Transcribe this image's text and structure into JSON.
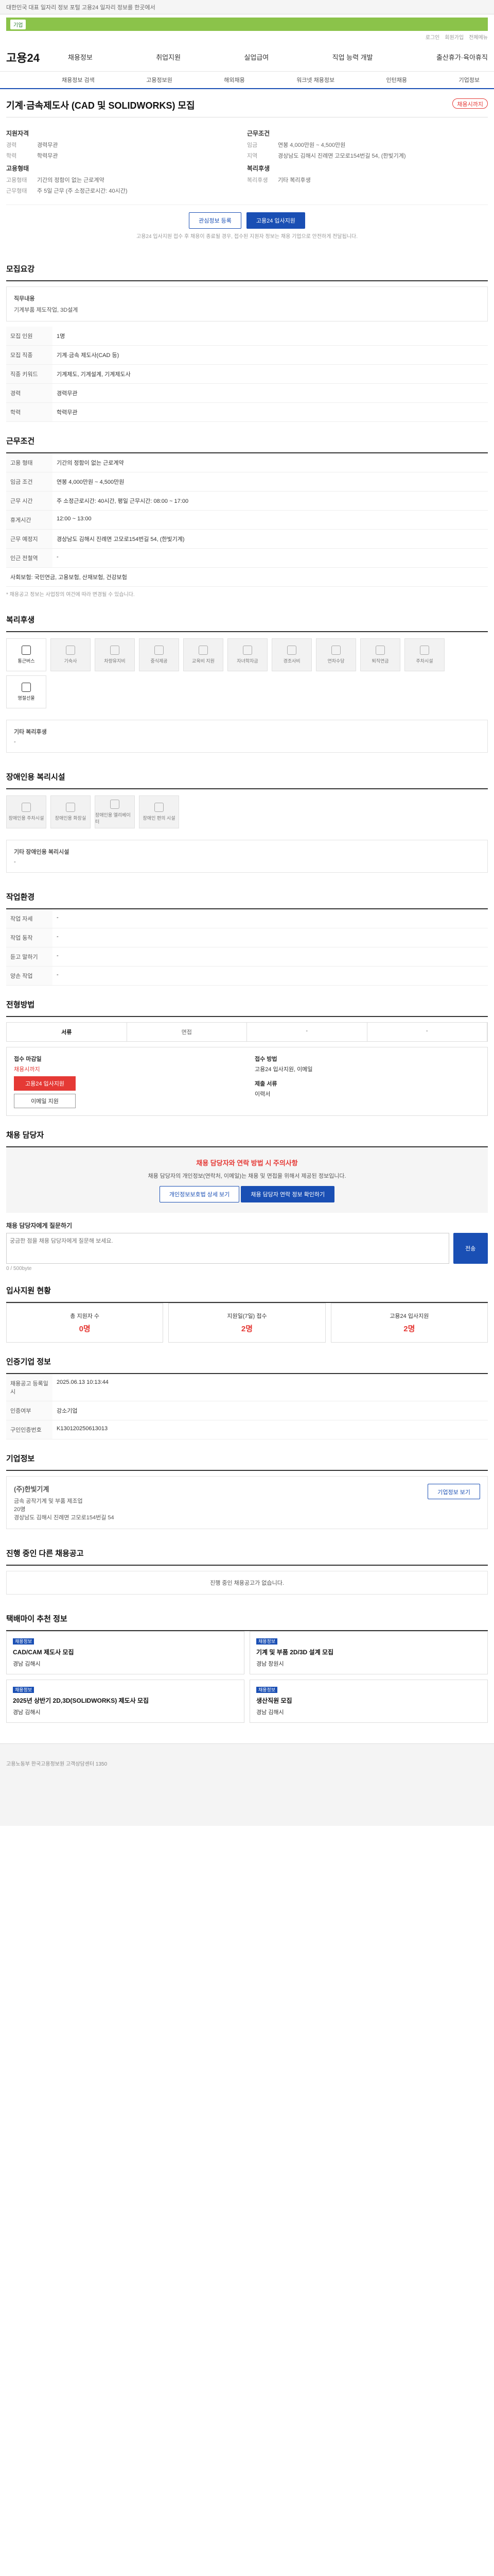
{
  "topbar": {
    "notice": "대한민국 대표 일자리 정보 포털 고용24 일자리 정보를 한곳에서"
  },
  "greenbar": {
    "tag": "기업"
  },
  "subline": [
    "로그인",
    "회원가입",
    "전체메뉴"
  ],
  "gnb": {
    "logo": "고용24",
    "menu": [
      "채용정보",
      "취업지원",
      "실업급여",
      "직업 능력 개발",
      "출산휴가·육아휴직"
    ]
  },
  "snb": [
    "채용정보 검색",
    "고용정보원",
    "해외채용",
    "워크넷 채용정보",
    "인턴채용",
    "기업정보"
  ],
  "job": {
    "title": "기계·금속제도사 (CAD 및 SOLIDWORKS) 모집",
    "badge": "채용시까지",
    "left_head": "지원자격",
    "left": [
      {
        "k": "경력",
        "v": "경력무관"
      },
      {
        "k": "학력",
        "v": "학력무관"
      }
    ],
    "left_head2": "고용형태",
    "left2": [
      {
        "k": "고용형태",
        "v": "기간의 정함이 없는 근로계약"
      },
      {
        "k": "근무형태",
        "v": "주 5일 근무 (주 소정근로시간: 40시간)"
      }
    ],
    "right_head": "근무조건",
    "right": [
      {
        "k": "임금",
        "v": "연봉 4,000만원 ~ 4,500만원"
      },
      {
        "k": "지역",
        "v": "경상남도 김해시 진례면 고모로154번길 54, (한빛기계)"
      }
    ],
    "right_head2": "복리후생",
    "right2": [
      {
        "k": "복리후생",
        "v": "기타 복리후생"
      }
    ]
  },
  "buttons": {
    "scrap": "관심정보 등록",
    "apply": "고용24 입사지원"
  },
  "note": "고용24 입사지원 접수 후 채용이 종료될 경우, 접수된 지원자 정보는 채용 기업으로 안전하게 전달됩니다.",
  "sections": {
    "recruit": "모집요강",
    "work": "근무조건",
    "welfare": "복리후생",
    "disability": "장애인용 복리시설",
    "workenv": "작업환경",
    "process": "전형방법",
    "apply_check": "채용 담당자",
    "stats": "입사지원 현황",
    "company_auth": "인증기업 정보",
    "company": "기업정보",
    "other_jobs": "진행 중인 다른 채용공고",
    "recommend": "택배마이 추천 정보"
  },
  "recruit": {
    "duty_label": "직무내용",
    "duty": "기계부품 제도작업, 3D설계",
    "rows": [
      {
        "h": "모집 인원",
        "v": "1명"
      },
      {
        "h": "모집 직종",
        "v": "기계·금속 제도사(CAD 등)"
      },
      {
        "h": "직종 키워드",
        "v": "기계제도, 기계설계, 기계제도사"
      },
      {
        "h": "경력",
        "v": "경력무관"
      },
      {
        "h": "학력",
        "v": "학력무관"
      }
    ]
  },
  "work": {
    "rows": [
      {
        "h": "고용 형태",
        "v": "기간의 정함이 없는 근로계약"
      },
      {
        "h": "근무 시간",
        "v": "주 소정근로시간: 40시간, 평일 근무시간: 08:00 ~ 17:00"
      },
      {
        "h": "휴게시간",
        "v": "12:00 ~ 13:00"
      },
      {
        "h": "근무 예정지",
        "v": "경상남도 김해시 진례면 고모로154번길 54, (한빛기계)"
      },
      {
        "h": "인근 전철역",
        "v": "-"
      }
    ],
    "wage_label": "임금 조건",
    "wage": "연봉 4,000만원 ~ 4,500만원",
    "insurance": "사회보험: 국민연금, 고용보험, 산재보험, 건강보험",
    "note": "* 채용공고 정보는 사업장의 여건에 따라 변경될 수 있습니다."
  },
  "welfare": {
    "items": [
      "통근버스",
      "기숙사",
      "차량유지비",
      "중식제공",
      "교육비 지원",
      "자녀학자금",
      "경조사비",
      "연차수당",
      "퇴직연금",
      "주차시설",
      "명절선물"
    ],
    "on": [
      0,
      10
    ],
    "etc_label": "기타 복리후생",
    "etc": "-"
  },
  "disability": {
    "items": [
      "장애인용 주차시설",
      "장애인용 화장실",
      "장애인용 엘리베이터",
      "장애인 편의 시설"
    ],
    "etc_label": "기타 장애인용 복리시설",
    "etc": "-"
  },
  "workenv": {
    "rows": [
      {
        "h": "작업 자세",
        "v": "-"
      },
      {
        "h": "작업 동작",
        "v": "-"
      },
      {
        "h": "듣고 말하기",
        "v": "-"
      },
      {
        "h": "양손 작업",
        "v": "-"
      }
    ]
  },
  "process": {
    "tabs": [
      "서류",
      "면접",
      "-",
      "-"
    ],
    "apply_label": "접수 마감일",
    "apply_date": "채용시까지",
    "apply_btn": "고용24 입사지원",
    "mail_btn": "이메일 지원",
    "method_label": "접수 방법",
    "method": "고용24 입사지원, 이메일",
    "doc_label": "제출 서류",
    "doc": "이력서"
  },
  "apply_check": {
    "title": "채용 담당자와 연락 방법 시 주의사항",
    "body": "채용 담당자의 개인정보(연락처, 이메일)는 채용 및 면접을 위해서 제공된 정보입니다.",
    "btn1": "개인정보보호법 상세 보기",
    "btn2": "채용 담당자 연락 정보 확인하기"
  },
  "question": {
    "label": "채용 담당자에게 질문하기",
    "placeholder": "궁금한 점을 채용 담당자에게 질문해 보세요.",
    "submit": "전송",
    "counter": "0 / 500byte"
  },
  "stats": [
    {
      "label": "총 지원자 수",
      "value": "0명"
    },
    {
      "label": "지원일(7일) 접수",
      "value": "2명"
    },
    {
      "label": "고용24 입사지원",
      "value": "2명"
    }
  ],
  "company_auth": {
    "rows": [
      {
        "h": "채용공고 등록일시",
        "v": "2025.06.13 10:13:44"
      },
      {
        "h": "인증여부",
        "v": "강소기업"
      },
      {
        "h": "구인인증번호",
        "v": "K130120250613013"
      }
    ]
  },
  "company": {
    "name": "(주)한빛기계",
    "industry": "금속 공작기계 및 부품 제조업",
    "employees": "20명",
    "ceo": "대표자",
    "address": "경상남도 김해시 진례면 고모로154번길 54",
    "btn": "기업정보 보기"
  },
  "other_jobs": {
    "empty": "진행 중인 채용공고가 없습니다."
  },
  "recommend": [
    {
      "tag": "채용정보",
      "title": "CAD/CAM 제도사 모집",
      "loc": "경남 김해시"
    },
    {
      "tag": "채용정보",
      "title": "기계 및 부품 2D/3D 설계 모집",
      "loc": "경남 창원시"
    },
    {
      "tag": "채용정보",
      "title": "2025년 상반기 2D,3D(SOLIDWORKS) 제도사 모집",
      "loc": "경남 김해시"
    },
    {
      "tag": "채용정보",
      "title": "생산직원 모집",
      "loc": "경남 김해시"
    }
  ],
  "footer": {
    "text": "고용노동부 한국고용정보원 고객상담센터 1350"
  }
}
